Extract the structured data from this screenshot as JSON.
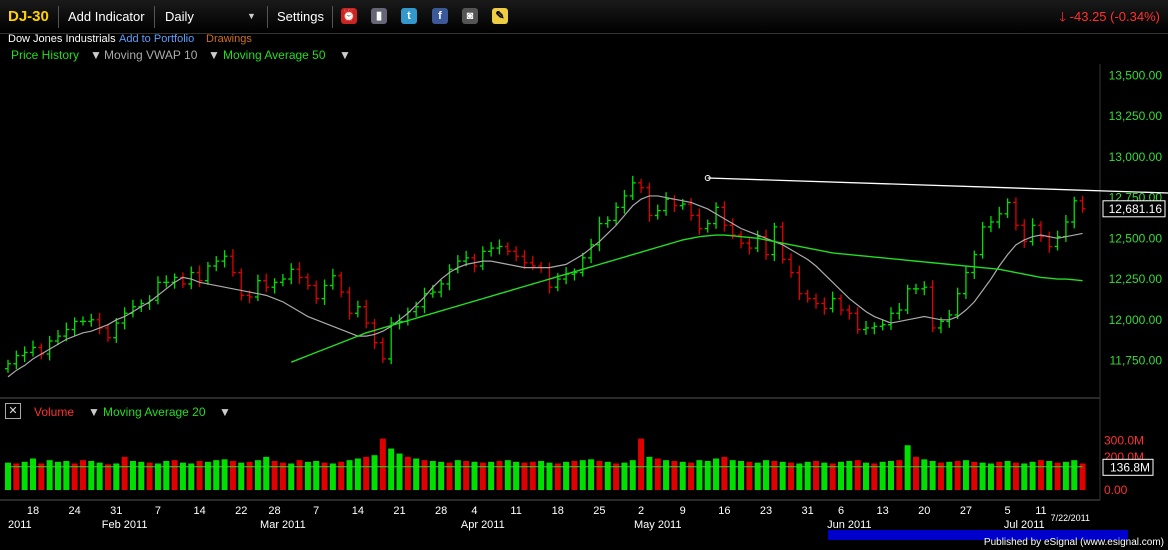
{
  "toolbar": {
    "symbol": "DJ-30",
    "add_indicator": "Add Indicator",
    "interval": "Daily",
    "settings": "Settings",
    "change": "-43.25 (-0.34%)",
    "icons": [
      "alarm-clock-icon",
      "book-icon",
      "twitter-icon",
      "facebook-icon",
      "camera-icon",
      "note-icon"
    ]
  },
  "subbar": {
    "name": "Dow Jones Industrials",
    "add_portfolio": "Add to Portfolio",
    "drawings": "Drawings"
  },
  "legend": {
    "price_history": "Price History",
    "vwap": "Moving VWAP 10",
    "ma50": "Moving Average 50"
  },
  "volume_legend": {
    "volume": "Volume",
    "ma20": "Moving Average 20"
  },
  "footer": "Published by eSignal (www.esignal.com)",
  "colors": {
    "up": "#00e000",
    "down": "#e00000",
    "ma50": "#22dd22",
    "vwap": "#aaaaaa",
    "axis": "#33dd33",
    "trend": "#ffffff"
  },
  "chart_data": [
    {
      "type": "ohlc",
      "ylim": [
        11600,
        13600
      ],
      "yticks": [
        11750,
        12000,
        12250,
        12500,
        12750,
        13000,
        13250,
        13500
      ],
      "ytick_labels": [
        "11,750.00",
        "12,000.00",
        "12,250.00",
        "12,500.00",
        "12,750.00",
        "13,000.00",
        "13,250.00",
        "13,500.00"
      ],
      "last_price_label": "12,681.16",
      "last_price": 12681,
      "closes": [
        11730,
        11780,
        11800,
        11830,
        11790,
        11870,
        11900,
        11940,
        11990,
        11990,
        12000,
        11950,
        11890,
        11980,
        12040,
        12080,
        12100,
        12120,
        12230,
        12230,
        12260,
        12220,
        12290,
        12240,
        12330,
        12360,
        12390,
        12290,
        12150,
        12140,
        12240,
        12200,
        12230,
        12250,
        12310,
        12260,
        12210,
        12130,
        12210,
        12270,
        12170,
        12040,
        12080,
        11980,
        11860,
        11760,
        11980,
        11990,
        12050,
        12080,
        12160,
        12170,
        12220,
        12310,
        12360,
        12380,
        12330,
        12420,
        12440,
        12450,
        12420,
        12390,
        12350,
        12330,
        12320,
        12200,
        12250,
        12280,
        12290,
        12380,
        12460,
        12590,
        12610,
        12690,
        12760,
        12840,
        12810,
        12640,
        12670,
        12740,
        12700,
        12710,
        12640,
        12560,
        12590,
        12690,
        12580,
        12520,
        12470,
        12440,
        12510,
        12400,
        12570,
        12370,
        12290,
        12160,
        12130,
        12100,
        12070,
        12130,
        12060,
        12040,
        11940,
        11950,
        11960,
        11970,
        12040,
        12060,
        12190,
        12190,
        12200,
        11950,
        11990,
        12030,
        12160,
        12290,
        12400,
        12570,
        12600,
        12650,
        12720,
        12580,
        12480,
        12580,
        12510,
        12450,
        12510,
        12600,
        12730,
        12681
      ],
      "vwap": [
        11650,
        11690,
        11720,
        11760,
        11790,
        11820,
        11850,
        11880,
        11900,
        11920,
        11930,
        11950,
        11970,
        12000,
        12020,
        12050,
        12080,
        12110,
        12150,
        12190,
        12230,
        12260,
        12250,
        12230,
        12220,
        12210,
        12200,
        12190,
        12180,
        12170,
        12160,
        12150,
        12130,
        12110,
        12080,
        12050,
        12020,
        12000,
        11980,
        11960,
        11940,
        11920,
        11900,
        11900,
        11910,
        11930,
        11960,
        12000,
        12040,
        12090,
        12140,
        12200,
        12250,
        12290,
        12320,
        12340,
        12350,
        12360,
        12360,
        12350,
        12340,
        12330,
        12320,
        12320,
        12320,
        12320,
        12330,
        12340,
        12370,
        12400,
        12440,
        12480,
        12530,
        12580,
        12640,
        12700,
        12740,
        12760,
        12760,
        12750,
        12740,
        12730,
        12720,
        12700,
        12680,
        12650,
        12620,
        12590,
        12560,
        12540,
        12520,
        12500,
        12480,
        12460,
        12430,
        12400,
        12370,
        12330,
        12280,
        12230,
        12180,
        12130,
        12090,
        12050,
        12020,
        12000,
        11980,
        11990,
        12000,
        12010,
        12020,
        12010,
        12000,
        12000,
        12020,
        12060,
        12110,
        12180,
        12250,
        12330,
        12400,
        12460,
        12490,
        12510,
        12520,
        12510,
        12500,
        12510,
        12520,
        12530
      ],
      "ma50_start_index": 34,
      "ma50": [
        11740,
        11760,
        11780,
        11800,
        11820,
        11840,
        11860,
        11880,
        11900,
        11920,
        11935,
        11950,
        11965,
        11980,
        11995,
        12010,
        12025,
        12040,
        12055,
        12070,
        12085,
        12100,
        12115,
        12130,
        12145,
        12160,
        12175,
        12190,
        12205,
        12220,
        12235,
        12250,
        12265,
        12280,
        12295,
        12310,
        12325,
        12340,
        12355,
        12370,
        12385,
        12400,
        12415,
        12430,
        12445,
        12460,
        12475,
        12490,
        12500,
        12510,
        12515,
        12520,
        12520,
        12515,
        12510,
        12505,
        12500,
        12490,
        12480,
        12470,
        12460,
        12450,
        12440,
        12430,
        12420,
        12410,
        12405,
        12400,
        12395,
        12390,
        12385,
        12380,
        12375,
        12370,
        12365,
        12360,
        12355,
        12350,
        12345,
        12340,
        12335,
        12330,
        12325,
        12320,
        12315,
        12310,
        12300,
        12290,
        12280,
        12270,
        12260,
        12255,
        12250,
        12250,
        12245,
        12240
      ],
      "trendline": [
        {
          "i": 84,
          "v": 12870
        },
        {
          "i": 150,
          "v": 12760
        }
      ]
    },
    {
      "type": "bar",
      "title": "Volume",
      "ylim": [
        0,
        350
      ],
      "yticks": [
        0,
        200,
        300
      ],
      "ytick_labels": [
        "0.00",
        "200.0M",
        "300.0M"
      ],
      "last_value_label": "136.8M",
      "ma20": 140,
      "values": [
        165,
        160,
        170,
        190,
        160,
        180,
        170,
        175,
        160,
        180,
        175,
        165,
        155,
        160,
        200,
        175,
        170,
        165,
        160,
        175,
        180,
        165,
        160,
        175,
        170,
        180,
        185,
        175,
        165,
        170,
        180,
        200,
        175,
        165,
        160,
        180,
        170,
        175,
        165,
        160,
        170,
        180,
        190,
        200,
        210,
        310,
        250,
        220,
        200,
        190,
        180,
        175,
        170,
        165,
        180,
        175,
        170,
        165,
        170,
        175,
        180,
        170,
        165,
        170,
        175,
        165,
        160,
        170,
        175,
        180,
        185,
        175,
        170,
        160,
        165,
        180,
        310,
        200,
        190,
        180,
        175,
        170,
        165,
        180,
        175,
        190,
        200,
        180,
        175,
        170,
        165,
        180,
        175,
        170,
        165,
        160,
        170,
        175,
        165,
        160,
        170,
        175,
        180,
        165,
        160,
        170,
        175,
        180,
        270,
        200,
        185,
        175,
        165,
        170,
        175,
        180,
        170,
        165,
        160,
        170,
        175,
        165,
        160,
        170,
        180,
        175,
        165,
        170,
        180,
        160
      ],
      "up_mask": "1011011100110101101101101110101100101101011010110101101010101100110101101011010101011101101101011010110101101011010101101011010110"
    }
  ],
  "x_axis": {
    "day_labels": [
      {
        "i": 3,
        "t": "18"
      },
      {
        "i": 8,
        "t": "24"
      },
      {
        "i": 13,
        "t": "31"
      },
      {
        "i": 18,
        "t": "7"
      },
      {
        "i": 23,
        "t": "14"
      },
      {
        "i": 28,
        "t": "22"
      },
      {
        "i": 32,
        "t": "28"
      },
      {
        "i": 37,
        "t": "7"
      },
      {
        "i": 42,
        "t": "14"
      },
      {
        "i": 47,
        "t": "21"
      },
      {
        "i": 52,
        "t": "28"
      },
      {
        "i": 56,
        "t": "4"
      },
      {
        "i": 61,
        "t": "11"
      },
      {
        "i": 66,
        "t": "18"
      },
      {
        "i": 71,
        "t": "25"
      },
      {
        "i": 76,
        "t": "2"
      },
      {
        "i": 81,
        "t": "9"
      },
      {
        "i": 86,
        "t": "16"
      },
      {
        "i": 91,
        "t": "23"
      },
      {
        "i": 96,
        "t": "31"
      },
      {
        "i": 100,
        "t": "6"
      },
      {
        "i": 105,
        "t": "13"
      },
      {
        "i": 110,
        "t": "20"
      },
      {
        "i": 115,
        "t": "27"
      },
      {
        "i": 120,
        "t": "5"
      },
      {
        "i": 124,
        "t": "11"
      }
    ],
    "month_labels": [
      {
        "i": 0,
        "t": "2011"
      },
      {
        "i": 14,
        "t": "Feb 2011"
      },
      {
        "i": 33,
        "t": "Mar 2011"
      },
      {
        "i": 57,
        "t": "Apr 2011"
      },
      {
        "i": 78,
        "t": "May 2011"
      },
      {
        "i": 101,
        "t": "Jun 2011"
      },
      {
        "i": 122,
        "t": "Jul 2011"
      }
    ],
    "last_date": "7/22/2011"
  }
}
